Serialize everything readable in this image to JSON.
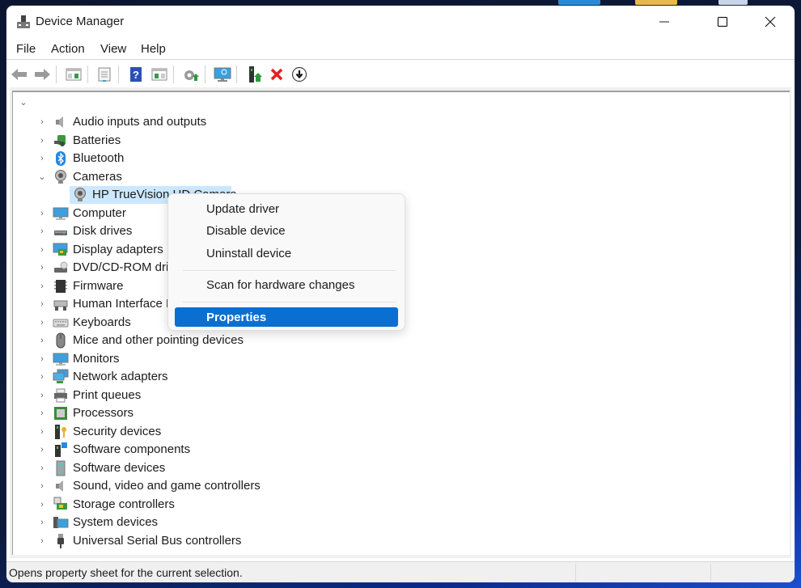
{
  "window": {
    "title": "Device Manager",
    "controls": {
      "minimize": "minimize",
      "maximize": "maximize",
      "close": "close"
    }
  },
  "menubar": [
    "File",
    "Action",
    "View",
    "Help"
  ],
  "toolbar": [
    {
      "name": "back",
      "icon": "back-arrow-icon"
    },
    {
      "name": "forward",
      "icon": "forward-arrow-icon"
    },
    {
      "name": "show-hide-console-tree",
      "icon": "console-tree-icon"
    },
    {
      "name": "properties",
      "icon": "properties-sheet-icon"
    },
    {
      "name": "help",
      "icon": "help-icon"
    },
    {
      "name": "show-hide-action-pane",
      "icon": "action-pane-icon"
    },
    {
      "name": "update-driver",
      "icon": "update-driver-icon"
    },
    {
      "name": "scan-hardware",
      "icon": "scan-monitor-icon"
    },
    {
      "name": "enable-device",
      "icon": "enable-device-icon"
    },
    {
      "name": "uninstall-device",
      "icon": "red-x-icon"
    },
    {
      "name": "disable-device",
      "icon": "down-arrow-circle-icon"
    }
  ],
  "tree": {
    "root_expanded": true,
    "categories": [
      {
        "label": "Audio inputs and outputs",
        "icon": "speaker-icon",
        "expanded": false
      },
      {
        "label": "Batteries",
        "icon": "battery-icon",
        "expanded": false
      },
      {
        "label": "Bluetooth",
        "icon": "bluetooth-icon",
        "expanded": false
      },
      {
        "label": "Cameras",
        "icon": "webcam-icon",
        "expanded": true,
        "children": [
          {
            "label": "HP TrueVision HD Camera",
            "icon": "webcam-icon",
            "selected": true
          }
        ]
      },
      {
        "label": "Computer",
        "icon": "monitor-icon",
        "expanded": false
      },
      {
        "label": "Disk drives",
        "icon": "disk-drive-icon",
        "expanded": false
      },
      {
        "label": "Display adapters",
        "icon": "display-adapter-icon",
        "expanded": false
      },
      {
        "label": "DVD/CD-ROM drives",
        "icon": "dvd-drive-icon",
        "expanded": false
      },
      {
        "label": "Firmware",
        "icon": "chip-icon",
        "expanded": false
      },
      {
        "label": "Human Interface Devices",
        "icon": "hid-icon",
        "expanded": false
      },
      {
        "label": "Keyboards",
        "icon": "keyboard-icon",
        "expanded": false
      },
      {
        "label": "Mice and other pointing devices",
        "icon": "mouse-icon",
        "expanded": false
      },
      {
        "label": "Monitors",
        "icon": "monitor-icon",
        "expanded": false
      },
      {
        "label": "Network adapters",
        "icon": "network-icon",
        "expanded": false
      },
      {
        "label": "Print queues",
        "icon": "printer-icon",
        "expanded": false
      },
      {
        "label": "Processors",
        "icon": "processor-icon",
        "expanded": false
      },
      {
        "label": "Security devices",
        "icon": "security-key-icon",
        "expanded": false
      },
      {
        "label": "Software components",
        "icon": "software-component-icon",
        "expanded": false
      },
      {
        "label": "Software devices",
        "icon": "software-device-icon",
        "expanded": false
      },
      {
        "label": "Sound, video and game controllers",
        "icon": "speaker-icon",
        "expanded": false
      },
      {
        "label": "Storage controllers",
        "icon": "storage-controller-icon",
        "expanded": false
      },
      {
        "label": "System devices",
        "icon": "system-device-icon",
        "expanded": false
      },
      {
        "label": "Universal Serial Bus controllers",
        "icon": "usb-icon",
        "expanded": false
      }
    ]
  },
  "context_menu": {
    "items": [
      {
        "label": "Update driver"
      },
      {
        "label": "Disable device"
      },
      {
        "label": "Uninstall device"
      },
      {
        "separator": true
      },
      {
        "label": "Scan for hardware changes"
      },
      {
        "separator": true
      },
      {
        "label": "Properties",
        "highlighted": true
      }
    ]
  },
  "statusbar": {
    "text": "Opens property sheet for the current selection."
  },
  "colors": {
    "accent": "#0a6fd1",
    "selection": "#cce8ff"
  }
}
